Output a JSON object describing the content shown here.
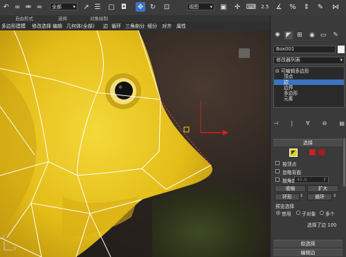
{
  "toolbar": {
    "filter_select": "全部",
    "viewport_select": "视图",
    "snap_number": "2.5",
    "percent_label": "%",
    "icons": [
      "undo-icon",
      "redo-icon",
      "link-icon",
      "unlink-icon",
      "bind-space-warp-icon",
      "select-object-icon",
      "select-by-name-icon",
      "rect-region-icon",
      "window-crossing-icon",
      "move-icon",
      "rotate-icon",
      "scale-icon",
      "pivot-icon",
      "select-manipulate-icon",
      "keyboard-shortcut-icon",
      "snap-toggle-icon",
      "angle-snap-icon",
      "percent-snap-icon",
      "spinner-snap-icon"
    ]
  },
  "ribbon": {
    "items": [
      "自由形式",
      "选择",
      "对象绘制"
    ]
  },
  "menubar": {
    "items": [
      "多边形建模",
      "修改选择",
      "编辑",
      "几何体(全部)",
      "边",
      "循环",
      "三角剖分",
      "细分",
      "对齐",
      "属性"
    ]
  },
  "viewport": {
    "gizmo_label": "",
    "axis_z": "Z",
    "axis_x": "X"
  },
  "panel": {
    "object_name": "Box001",
    "modifier_list": "修改器列表",
    "stack": [
      {
        "label": "可编辑多边形",
        "selected": false,
        "indent": 0
      },
      {
        "label": "顶点",
        "selected": false,
        "indent": 1
      },
      {
        "label": "边",
        "selected": true,
        "indent": 1
      },
      {
        "label": "边界",
        "selected": false,
        "indent": 1
      },
      {
        "label": "多边形",
        "selected": false,
        "indent": 1
      },
      {
        "label": "元素",
        "selected": false,
        "indent": 1
      }
    ],
    "selection": {
      "title": "选择",
      "by_vertex": "按顶点",
      "ignore_backfacing": "忽略背面",
      "by_angle": "按角度:",
      "angle_value": "45.0",
      "shrink": "收缩",
      "grow": "扩大",
      "ring": "环形",
      "loop": "循环",
      "preview_selection": "预览选择",
      "disabled": "禁用",
      "subobject": "子对象",
      "multiple": "多个",
      "status": "选择了边 100"
    },
    "soft_selection": "软选择",
    "edit_edges": "编辑边"
  },
  "colors": {
    "accent": "#3a73c4",
    "fish_yellow": "#e8c21a",
    "wire": "#ffffff",
    "edge_select": "#d23b3b"
  }
}
